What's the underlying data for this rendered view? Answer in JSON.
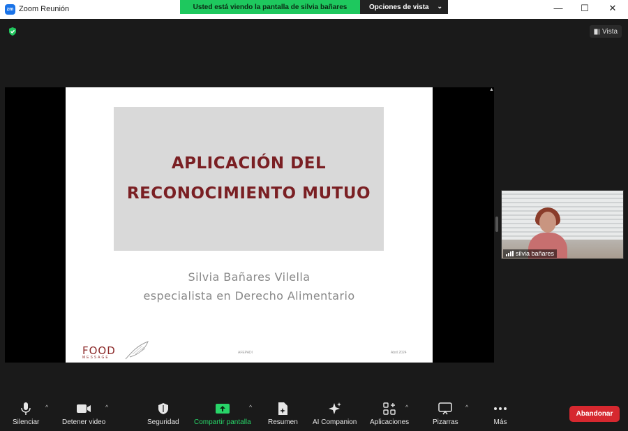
{
  "window": {
    "title": "Zoom Reunión",
    "logo_text": "zm",
    "minimize": "—",
    "maximize": "☐",
    "close": "✕"
  },
  "banner": {
    "sharing_text": "Usted está viendo la pantalla de silvia bañares",
    "view_options": "Opciones de vista",
    "view_options_chevron": "⌄"
  },
  "header": {
    "vista_label": "Vista"
  },
  "slide": {
    "title_line1": "APLICACIÓN DEL",
    "title_line2": "RECONOCIMIENTO MUTUO",
    "author": "Silvia Bañares Vilella",
    "role": "especialista en Derecho Alimentario",
    "logo_main": "FOOD",
    "logo_sub": "MESSAGE",
    "footer_mid": "AFEPADI",
    "footer_right": "Abril 2024"
  },
  "participant": {
    "name": "silvia bañares"
  },
  "toolbar": {
    "mute": "Silenciar",
    "stop_video": "Detener video",
    "security": "Seguridad",
    "share_screen": "Compartir pantalla",
    "summary": "Resumen",
    "ai_companion": "AI Companion",
    "apps": "Aplicaciones",
    "whiteboards": "Pizarras",
    "more": "Más",
    "leave": "Abandonar",
    "caret": "^"
  },
  "colors": {
    "share_banner": "#1ec85e",
    "slide_title": "#7a1f23",
    "leave_button": "#d6282f",
    "share_icon": "#28d468"
  }
}
